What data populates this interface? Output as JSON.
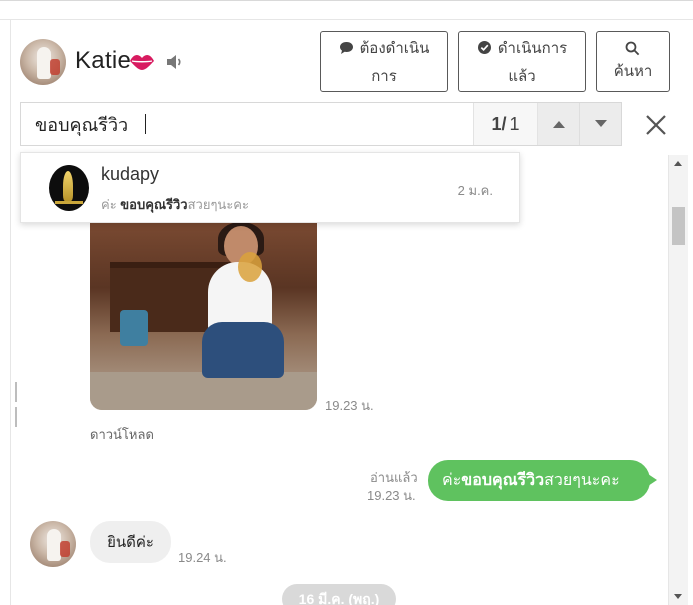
{
  "header": {
    "contact_name": "Katie",
    "buttons": {
      "todo_line1": "ต้องดำเนิน",
      "todo_line2": "การ",
      "done_line1": "ดำเนินการ",
      "done_line2": "แล้ว",
      "search_label": "ค้นหา"
    },
    "icons": [
      "lips-icon",
      "speaker-icon",
      "speech-bubble-icon",
      "check-circle-icon",
      "search-icon"
    ]
  },
  "search": {
    "query": "ขอบคุณรีวิว",
    "current": "1/",
    "total": "1"
  },
  "dropdown": {
    "name": "kudapy",
    "snippet_prefix": "ค่ะ ",
    "snippet_match": "ขอบคุณรีวิว",
    "snippet_suffix": "สวยๆนะคะ",
    "date": "2 ม.ค."
  },
  "messages": {
    "photo_time": "19.23 น.",
    "download_label": "ดาวน์โหลด",
    "read_label": "อ่านแล้ว",
    "sent_time": "19.23 น.",
    "sent_prefix": "ค่ะ ",
    "sent_match": "ขอบคุณรีวิว",
    "sent_suffix": "สวยๆนะคะ",
    "received_text": "ยินดีค่ะ",
    "received_time": "19.24 น.",
    "date_separator": "16 มี.ค. (พฤ.)"
  },
  "colors": {
    "sent_bubble": "#5fc25f",
    "received_bubble": "#efefef",
    "lips": "#d81b60"
  }
}
